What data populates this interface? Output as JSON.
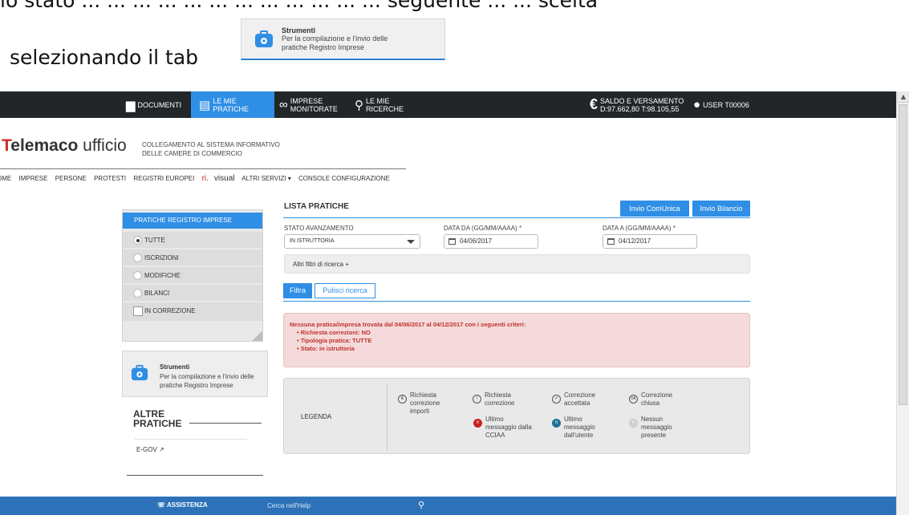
{
  "doc": {
    "top_line": "lo stato ... ... ... ... ... ... ... ... ... ... ... ... seguente ... ... scelta",
    "selezionando": "selezionando il tab"
  },
  "callout": {
    "title": "Strumenti",
    "description": "Per la compilazione e l'invio delle pratiche Registro Imprese"
  },
  "topnav": {
    "documenti": "DOCUMENTI",
    "le_mie_pratiche": "LE MIE PRATICHE",
    "imprese_1": "IMPRESE",
    "imprese_2": "MONITORATE",
    "ricerche_1": "LE MIE",
    "ricerche_2": "RICERCHE",
    "saldo_1": "SALDO E VERSAMENTO",
    "saldo_2": "D:97.662,80 T:98.105,55",
    "user": "USER T00006",
    "euro_symbol": "€"
  },
  "brand": {
    "t": "T",
    "elemaco": "elemaco",
    "ufficio": " ufficio",
    "sub_1": "COLLEGAMENTO AL SISTEMA INFORMATIVO",
    "sub_2": "DELLE CAMERE DI COMMERCIO"
  },
  "menu": {
    "home": "OME",
    "imprese": "IMPRESE",
    "persone": "PERSONE",
    "protesti": "PROTESTI",
    "registri": "REGISTRI EUROPEI",
    "ri": "ri.",
    "visual": "visual",
    "altri": "ALTRI SERVIZI ▾",
    "console": "CONSOLE CONFIGURAZIONE"
  },
  "left_panel": {
    "header": "PRATICHE REGISTRO IMPRESE",
    "options": [
      "TUTTE",
      "ISCRIZIONI",
      "MODIFICHE",
      "BILANCI"
    ],
    "checkbox": "IN CORREZIONE"
  },
  "tools": {
    "title": "Strumenti",
    "description": "Per la compilazione e l'invio delle pratiche Registro Imprese"
  },
  "altre": {
    "line1": "ALTRE",
    "line2": "PRATICHE",
    "egov": "E-GOV ↗"
  },
  "main": {
    "title": "LISTA PRATICHE",
    "btn_comunica": "Invio ComUnica",
    "btn_bilancio": "Invio Bilancio",
    "stato_label": "STATO AVANZAMENTO",
    "stato_value": "IN ISTRUTTORIA",
    "data_da_label": "DATA DA (GG/MM/AAAA) *",
    "data_da_value": "04/06/2017",
    "data_a_label": "DATA A (GG/MM/AAAA) *",
    "data_a_value": "04/12/2017",
    "altri_filtri": "Altri filtri di ricerca +",
    "filtra": "Filtra",
    "pulisci": "Pulisci ricerca"
  },
  "alert": {
    "headline": "Nessuna pratica/impresa trovata dal 04/06/2017 al 04/12/2017 con i seguenti criteri:",
    "items": [
      "Richiesta correzioni: NO",
      "Tipologia pratica: TUTTE",
      "Stato: in istruttoria"
    ]
  },
  "legend": {
    "label": "LEGENDA",
    "items": [
      {
        "l1": "Richiesta",
        "l2": "correzione",
        "l3": "importi",
        "glyph": "€"
      },
      {
        "l1": "Richiesta",
        "l2": "correzione",
        "l3": "",
        "glyph": "!"
      },
      {
        "l1": "Correzione",
        "l2": "accettata",
        "l3": "",
        "glyph": "✓"
      },
      {
        "l1": "Correzione",
        "l2": "chiusa",
        "l3": "",
        "glyph": "ok"
      },
      {
        "l1": "Ultimo",
        "l2": "messaggio dalla",
        "l3": "CCIAA",
        "glyph": "n"
      },
      {
        "l1": "Ultimo",
        "l2": "messaggio",
        "l3": "dall'utente",
        "glyph": "n"
      },
      {
        "l1": "Nessun",
        "l2": "messaggio",
        "l3": "presente",
        "glyph": "n"
      }
    ]
  },
  "footer": {
    "assistenza": "ASSISTENZA",
    "help": "Cerca nell'Help",
    "search_glyph": "⚲"
  },
  "colors": {
    "nav_bg": "#222629",
    "accent": "#2f8ee5",
    "footer": "#2d72b8",
    "alert_bg": "#f4dada",
    "alert_text": "#c0322b"
  }
}
